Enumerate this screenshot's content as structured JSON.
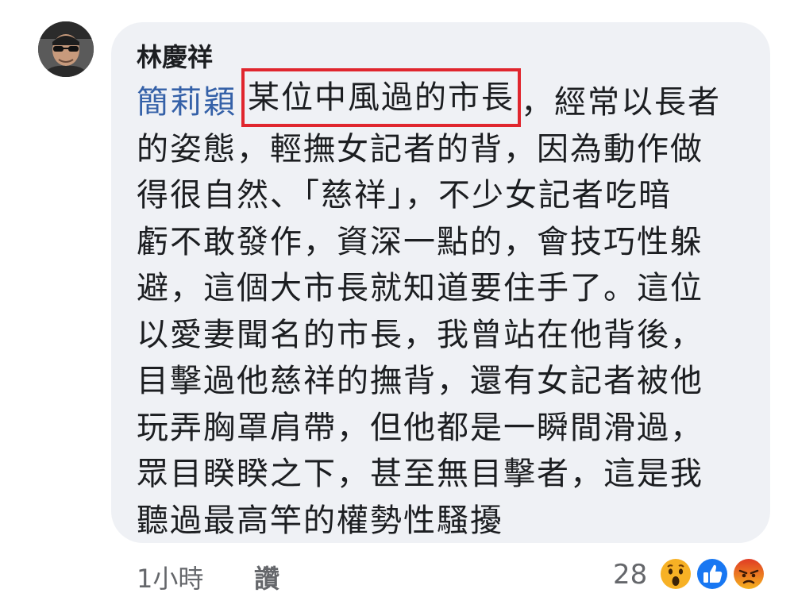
{
  "comment": {
    "author": "林慶祥",
    "mention": "簡莉穎",
    "highlighted_text": "某位中風過的市長",
    "line1_rest": "，經常以長者",
    "lines": [
      "的姿態，輕撫女記者的背，因為動作做",
      "得很自然、「慈祥」，不少女記者吃暗",
      "虧不敢發作，資深一點的，會技巧性躲",
      "避，這個大市長就知道要住手了。這位",
      "以愛妻聞名的市長，我曾站在他背後，",
      "目擊過他慈祥的撫背，還有女記者被他",
      "玩弄胸罩肩帶，但他都是一瞬間滑過，",
      "眾目睽睽之下，甚至無目擊者，這是我",
      "聽過最高竿的權勢性騷擾"
    ]
  },
  "footer": {
    "time": "1小時",
    "like_label": "讚",
    "reaction_count": "28"
  },
  "reactions": [
    {
      "name": "wow-reaction-icon",
      "color": "#f7b125"
    },
    {
      "name": "like-reaction-icon",
      "color": "#1877f2"
    },
    {
      "name": "angry-reaction-icon",
      "color": "#e9710f"
    }
  ],
  "colors": {
    "bubble": "#eff1f5",
    "mention": "#3561a8",
    "highlight_border": "#e0262e",
    "secondary_text": "#65676b"
  }
}
